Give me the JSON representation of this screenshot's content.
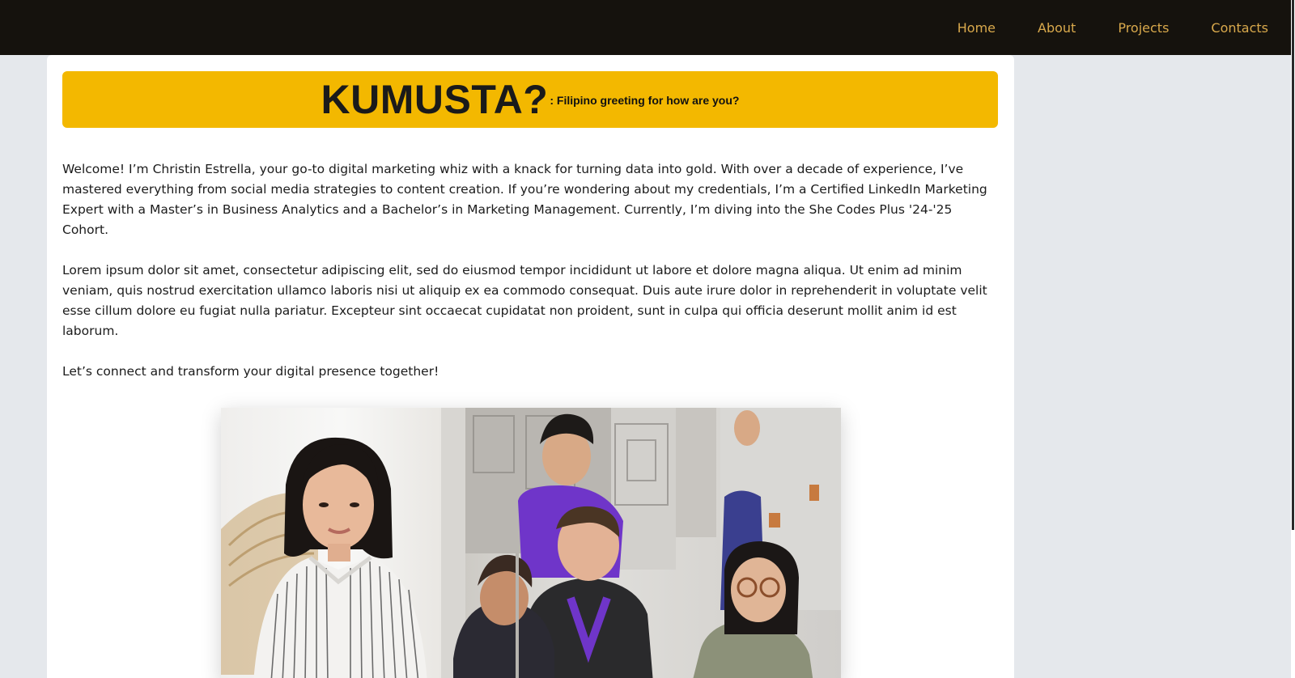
{
  "nav": {
    "items": [
      {
        "label": "Home"
      },
      {
        "label": "About"
      },
      {
        "label": "Projects"
      },
      {
        "label": "Contacts"
      }
    ]
  },
  "hero": {
    "title": "KUMUSTA?",
    "subtitle": ": Filipino greeting for how are you?"
  },
  "content": {
    "paragraphs": [
      "Welcome! I’m Christin Estrella, your go-to digital marketing whiz with a knack for turning data into gold. With over a decade of experience, I’ve mastered everything from social media strategies to content creation. If you’re wondering about my credentials, I’m a Certified LinkedIn Marketing Expert with a Master’s in Business Analytics and a Bachelor’s in Marketing Management. Currently, I’m diving into the She Codes Plus '24-'25 Cohort.",
      "Lorem ipsum dolor sit amet, consectetur adipiscing elit, sed do eiusmod tempor incididunt ut labore et dolore magna aliqua. Ut enim ad minim veniam, quis nostrud exercitation ullamco laboris nisi ut aliquip ex ea commodo consequat. Duis aute irure dolor in reprehenderit in voluptate velit esse cillum dolore eu fugiat nulla pariatur. Excepteur sint occaecat cupidatat non proident, sunt in culpa qui officia deserunt mollit anim id est laborum.",
      "Let’s connect and transform your digital presence together!"
    ]
  },
  "colors": {
    "nav_bg": "#15120d",
    "nav_text": "#d9a94c",
    "hero_bg": "#f3b800",
    "page_bg": "#e5e8ec"
  }
}
